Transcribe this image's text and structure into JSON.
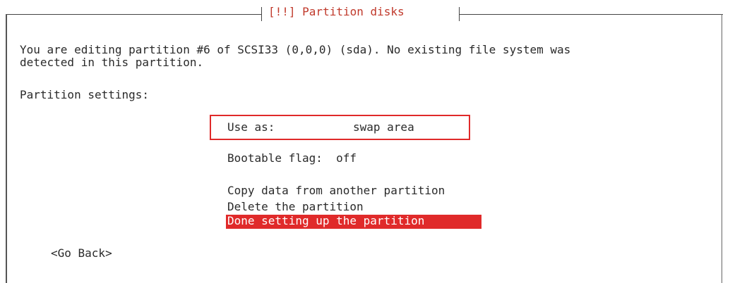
{
  "dialog": {
    "title": "[!!] Partition disks",
    "description": "You are editing partition #6 of SCSI33 (0,0,0) (sda). No existing file system was\ndetected in this partition.",
    "settings_label": "Partition settings:"
  },
  "menu": {
    "use_as_label": "Use as:",
    "use_as_value": "swap area",
    "bootable_flag": "Bootable flag:  off",
    "copy_data": "Copy data from another partition",
    "delete": "Delete the partition",
    "done": "Done setting up the partition"
  },
  "buttons": {
    "go_back": "<Go Back>"
  },
  "colors": {
    "accent": "#e02a2a",
    "title": "#c0392b",
    "text": "#2a2a2a"
  }
}
